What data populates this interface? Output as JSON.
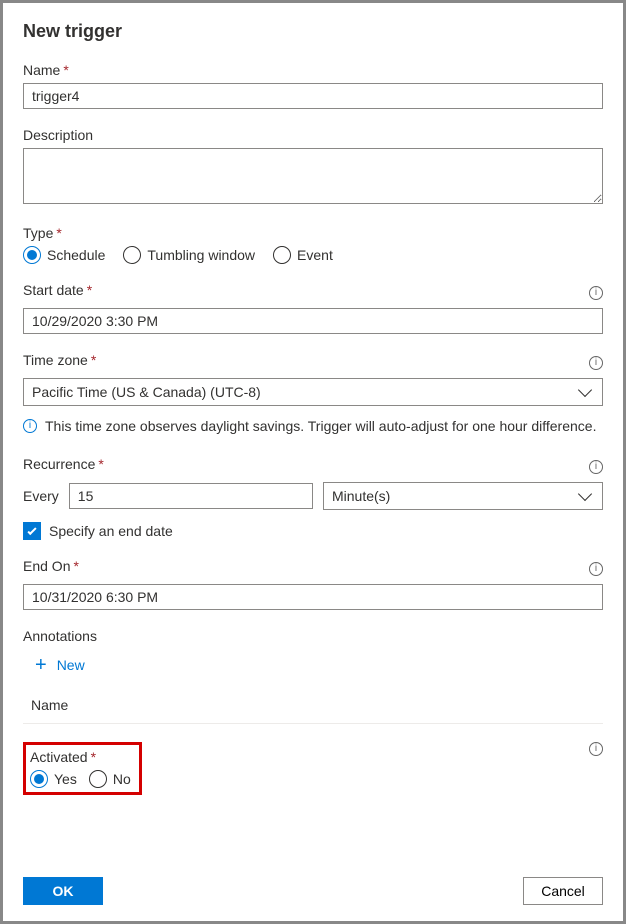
{
  "title": "New trigger",
  "name": {
    "label": "Name",
    "value": "trigger4"
  },
  "description": {
    "label": "Description",
    "value": ""
  },
  "type": {
    "label": "Type",
    "options": [
      "Schedule",
      "Tumbling window",
      "Event"
    ],
    "selected": "Schedule"
  },
  "start_date": {
    "label": "Start date",
    "value": "10/29/2020 3:30 PM"
  },
  "time_zone": {
    "label": "Time zone",
    "value": "Pacific Time (US & Canada) (UTC-8)",
    "help": "This time zone observes daylight savings. Trigger will auto-adjust for one hour difference."
  },
  "recurrence": {
    "label": "Recurrence",
    "every_label": "Every",
    "every_value": "15",
    "unit": "Minute(s)"
  },
  "specify_end": {
    "label": "Specify an end date",
    "checked": true
  },
  "end_on": {
    "label": "End On",
    "value": "10/31/2020 6:30 PM"
  },
  "annotations": {
    "label": "Annotations",
    "new_label": "New",
    "column_header": "Name"
  },
  "activated": {
    "label": "Activated",
    "options": [
      "Yes",
      "No"
    ],
    "selected": "Yes"
  },
  "buttons": {
    "ok": "OK",
    "cancel": "Cancel"
  }
}
